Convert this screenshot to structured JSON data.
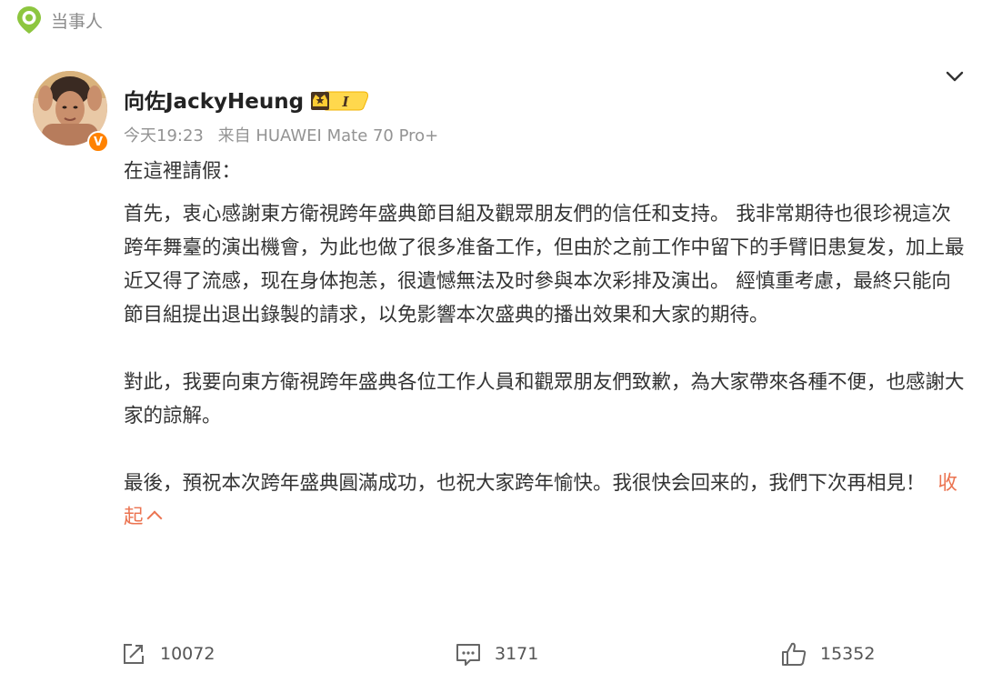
{
  "header": {
    "tag_label": "当事人",
    "tag_icon": "location-pin-icon"
  },
  "post": {
    "author": {
      "name": "向佐JackyHeung",
      "verified_badge": "V",
      "rank_badge_text": "I"
    },
    "meta": {
      "time": "今天19:23",
      "source": "来自 HUAWEI Mate 70 Pro+"
    },
    "content": {
      "p1": "在這裡請假：",
      "p2": "首先，衷心感謝東方衛視跨年盛典節目組及觀眾朋友們的信任和支持。 我非常期待也很珍視這次跨年舞臺的演出機會，为此也做了很多准备工作，但由於之前工作中留下的手臂旧患复发，加上最近又得了流感，现在身体抱恙，很遺憾無法及时參與本次彩排及演出。 經慎重考慮，最終只能向節目組提出退出錄製的請求，以免影響本次盛典的播出效果和大家的期待。",
      "p3": "對此，我要向東方衛視跨年盛典各位工作人員和觀眾朋友們致歉，為大家帶來各種不便，也感謝大家的諒解。",
      "p4": "最後，預祝本次跨年盛典圓滿成功，也祝大家跨年愉快。我很快会回来的，我們下次再相見！",
      "collapse_label": "收起"
    },
    "actions": {
      "forward": "10072",
      "comment": "3171",
      "like": "15352"
    }
  },
  "colors": {
    "accent": "#eb7350",
    "verified": "#ff8200",
    "meta": "#939393",
    "tag_icon": "#8dc63f"
  }
}
